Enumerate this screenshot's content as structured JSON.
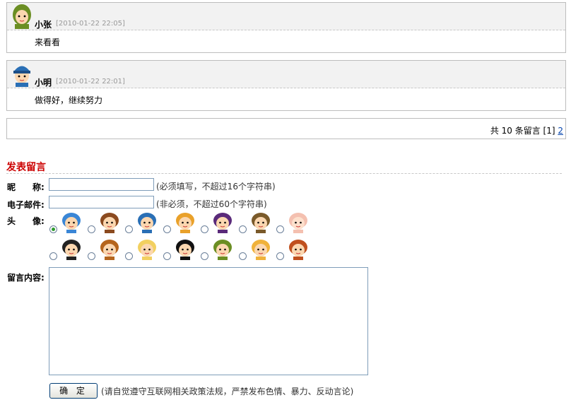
{
  "messages": [
    {
      "author": "小张",
      "time": "[2010-01-22 22:05]",
      "content": "来看看",
      "avatar_icon": "girl-green-hair-avatar-icon"
    },
    {
      "author": "小明",
      "time": "[2010-01-22 22:01]",
      "content": "做得好，继续努力",
      "avatar_icon": "boy-blue-cap-avatar-icon"
    }
  ],
  "pager": {
    "prefix": "共 10 条留言 [1]",
    "next_page": "2"
  },
  "form": {
    "title": "发表留言",
    "nickname_label": "昵　　称:",
    "nickname_value": "",
    "nickname_hint": "(必须填写，不超过16个字符串)",
    "email_label": "电子邮件:",
    "email_value": "",
    "email_hint": "(非必须，不超过60个字符串)",
    "avatar_label": "头　　像:",
    "avatars_selected_index": 0,
    "avatars": [
      "boy-blue-cap-icon",
      "boy-brown-hair-icon",
      "boy-blue-hat-icon",
      "boy-spiky-hair-icon",
      "girl-purple-glasses-icon",
      "man-detective-hat-icon",
      "baby-face-icon",
      "girl-black-hair-icon",
      "girl-braids-icon",
      "girl-blonde-glasses-icon",
      "girl-pigtails-icon",
      "girl-green-hair-icon",
      "girl-bow-icon",
      "girl-red-hair-icon"
    ],
    "content_label": "留言内容:",
    "content_value": "",
    "submit_label": "确 定",
    "submit_hint": "(请自觉遵守互联网相关政策法规，严禁发布色情、暴力、反动言论)"
  }
}
